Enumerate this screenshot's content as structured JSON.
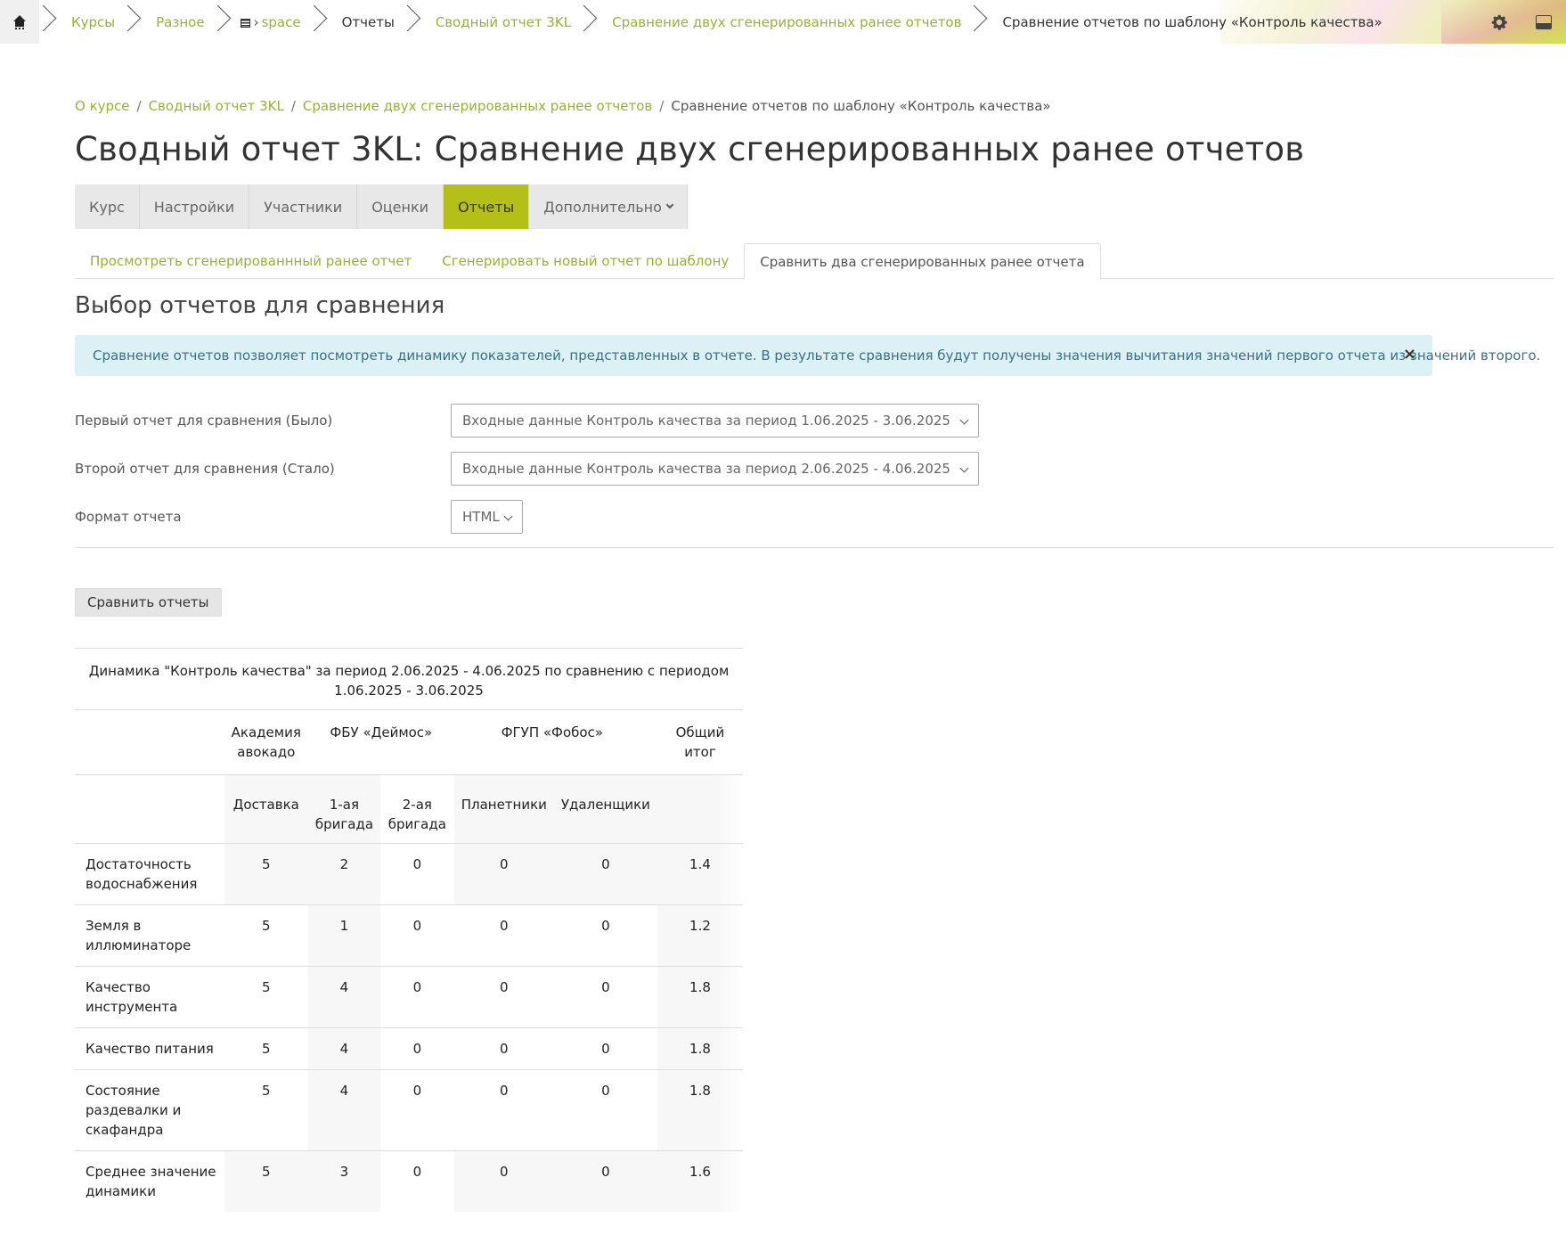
{
  "topnav": {
    "home_icon": "home-icon",
    "items": [
      {
        "label": "Курсы",
        "link": true
      },
      {
        "label": "Разное",
        "link": true
      },
      {
        "label": "space",
        "link": true,
        "icon": "course-icon"
      },
      {
        "label": "Отчеты",
        "link": false
      },
      {
        "label": "Сводный отчет 3KL",
        "link": true
      },
      {
        "label": "Сравнение двух сгенерированных ранее отчетов",
        "link": true
      },
      {
        "label": "Сравнение отчетов по шаблону «Контроль качества»",
        "link": false
      }
    ],
    "right_icons": [
      "gear-icon",
      "sidebar-icon"
    ]
  },
  "breadcrumb": [
    {
      "label": "О курсе",
      "link": true
    },
    {
      "label": "Сводный отчет 3KL",
      "link": true
    },
    {
      "label": "Сравнение двух сгенерированных ранее отчетов",
      "link": true
    },
    {
      "label": "Сравнение отчетов по шаблону «Контроль качества»",
      "link": false
    }
  ],
  "page_title": "Сводный отчет 3KL: Сравнение двух сгенерированных ранее отчетов",
  "course_nav": {
    "items": [
      "Курс",
      "Настройки",
      "Участники",
      "Оценки",
      "Отчеты",
      "Дополнительно"
    ],
    "active": "Отчеты",
    "accent": "#b4c018"
  },
  "tabs": {
    "items": [
      "Просмотреть сгенерированнный ранее отчет",
      "Сгенерировать новый отчет по шаблону",
      "Сравнить два сгенерированных ранее отчета"
    ],
    "active_index": 2
  },
  "section_title": "Выбор отчетов для сравнения",
  "alert": {
    "text": "Сравнение отчетов позволяет посмотреть динамику показателей, представленных в отчете. В результате сравнения будут получены значения вычитания значений первого отчета из значений второго.",
    "close": "×"
  },
  "form": {
    "first": {
      "label": "Первый отчет для сравнения (Было)",
      "value": "Входные данные Контроль качества за период 1.06.2025 - 3.06.2025"
    },
    "second": {
      "label": "Второй отчет для сравнения (Стало)",
      "value": "Входные данные Контроль качества за период 2.06.2025 - 4.06.2025"
    },
    "format": {
      "label": "Формат отчета",
      "value": "HTML"
    },
    "submit": "Сравнить отчеты"
  },
  "report": {
    "caption": "Динамика \"Контроль качества\" за период 2.06.2025 - 4.06.2025 по сравнению с периодом 1.06.2025 - 3.06.2025",
    "groups": [
      "Академия авокадо",
      "ФБУ «Деймос»",
      "ФГУП «Фобос»",
      "Общий итог"
    ],
    "subheaders": [
      "Доставка",
      "1-ая бригада",
      "2-ая бригада",
      "Планетники",
      "Удаленщики"
    ],
    "rows": [
      {
        "name": "Достаточность водоснабжения",
        "values": [
          "5",
          "2",
          "0",
          "0",
          "0",
          "1.4"
        ]
      },
      {
        "name": "Земля в иллюминаторе",
        "values": [
          "5",
          "1",
          "0",
          "0",
          "0",
          "1.2"
        ]
      },
      {
        "name": "Качество инструмента",
        "values": [
          "5",
          "4",
          "0",
          "0",
          "0",
          "1.8"
        ]
      },
      {
        "name": "Качество питания",
        "values": [
          "5",
          "4",
          "0",
          "0",
          "0",
          "1.8"
        ]
      },
      {
        "name": "Состояние раздевалки и скафандра",
        "values": [
          "5",
          "4",
          "0",
          "0",
          "0",
          "1.8"
        ]
      },
      {
        "name": "Среднее значение динамики",
        "values": [
          "5",
          "3",
          "0",
          "0",
          "0",
          "1.6"
        ]
      }
    ]
  }
}
